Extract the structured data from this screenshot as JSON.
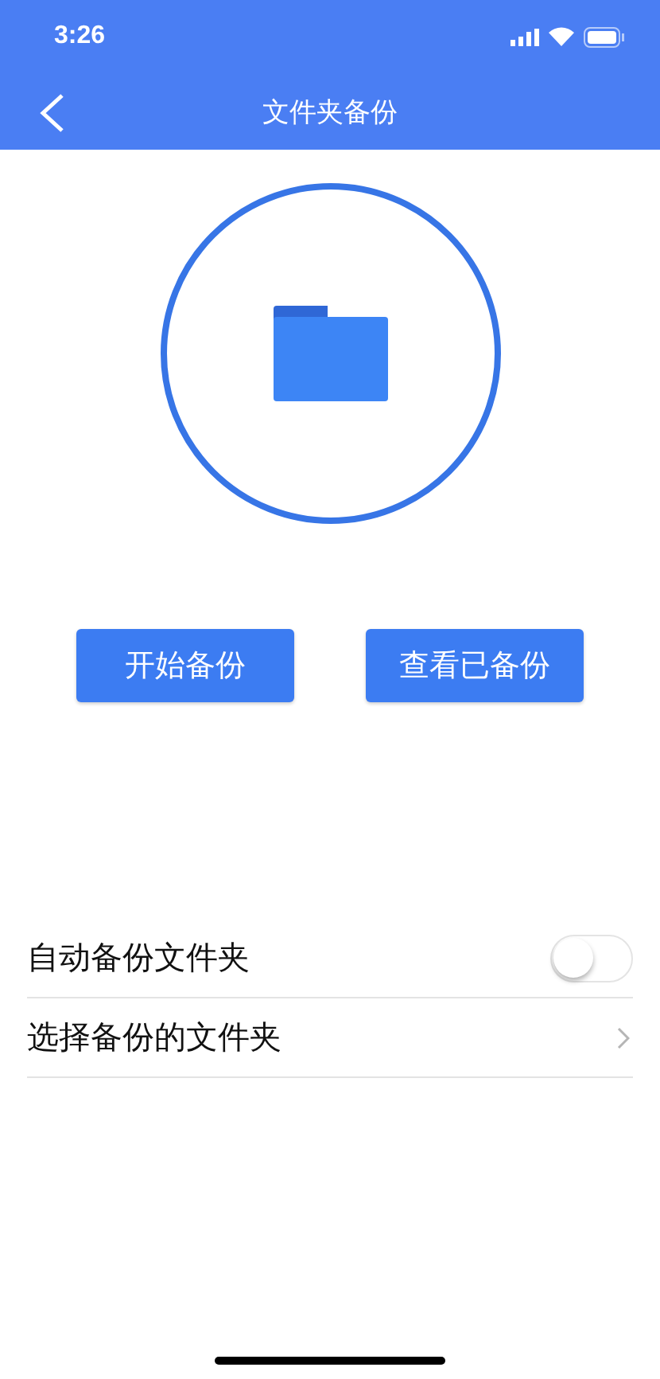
{
  "status_bar": {
    "time": "3:26"
  },
  "nav_bar": {
    "title": "文件夹备份"
  },
  "buttons": [
    {
      "label": "开始备份"
    },
    {
      "label": "查看已备份"
    }
  ],
  "settings": [
    {
      "kind": "toggle",
      "label": "自动备份文件夹",
      "on": false
    },
    {
      "kind": "link",
      "label": "选择备份的文件夹"
    }
  ]
}
